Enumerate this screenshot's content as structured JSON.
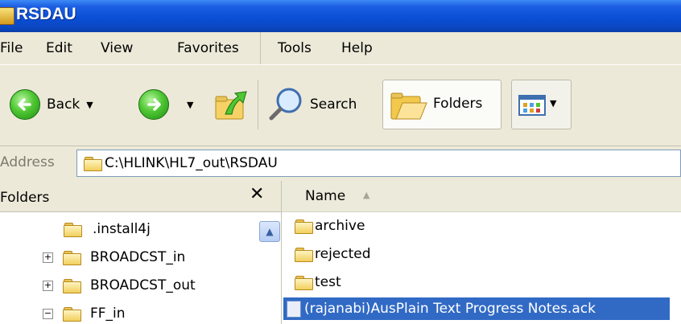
{
  "window": {
    "title": "RSDAU"
  },
  "menu": [
    "File",
    "Edit",
    "View",
    "Favorites",
    "Tools",
    "Help"
  ],
  "toolbar": {
    "back_label": "Back",
    "search_label": "Search",
    "folders_label": "Folders"
  },
  "address": {
    "label": "Address",
    "path": "C:\\HLINK\\HL7_out\\RSDAU"
  },
  "folders_pane": {
    "title": "Folders",
    "close_glyph": "✕",
    "tree": [
      {
        "label": ".install4j",
        "expander": ""
      },
      {
        "label": "BROADCST_in",
        "expander": "+"
      },
      {
        "label": "BROADCST_out",
        "expander": "+"
      },
      {
        "label": "FF_in",
        "expander": "−"
      }
    ]
  },
  "file_list": {
    "column_name": "Name",
    "items": [
      "archive",
      "rejected",
      "test"
    ],
    "selected_file": "(rajanabi)AusPlain Text Progress Notes.ack"
  },
  "colors": {
    "title_bar": "#0a4fd6",
    "chrome": "#ECE9D8",
    "selection": "#316ac5"
  }
}
